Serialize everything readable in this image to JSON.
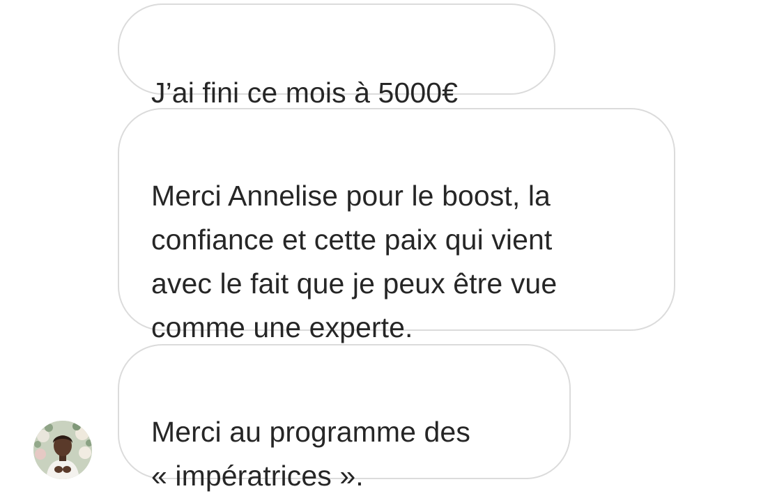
{
  "messages": [
    {
      "text": "J’ai fini ce mois à 5000€"
    },
    {
      "text": "Merci Annelise pour le boost, la\nconfiance et cette paix qui vient\navec le fait que je peux être vue\ncomme une experte."
    },
    {
      "text": "Merci au programme des\n« impératrices »."
    }
  ],
  "sender": {
    "avatar_icon": "profile-photo"
  },
  "colors": {
    "bubble_border": "#dbdbdb",
    "text": "#262626",
    "background": "#ffffff"
  }
}
